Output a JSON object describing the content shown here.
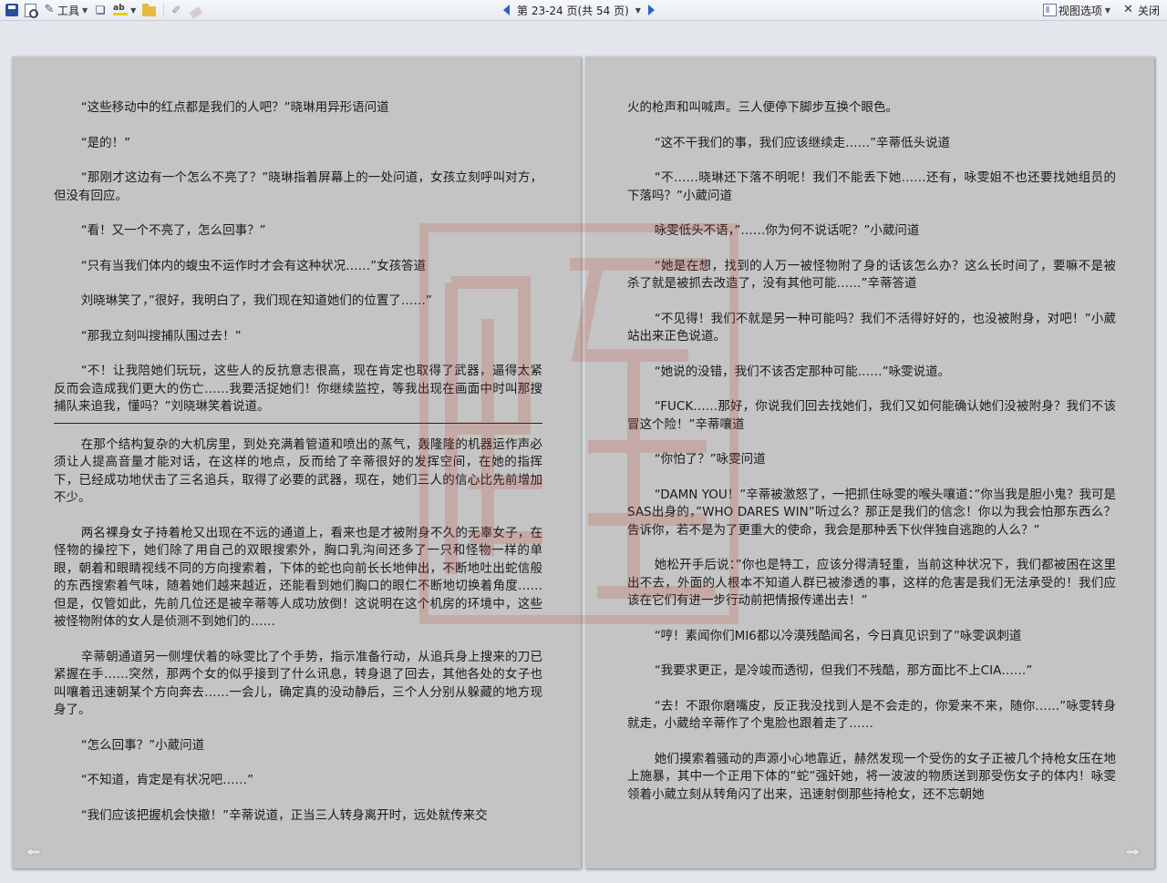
{
  "toolbar": {
    "tools_label": "工具",
    "page_info": "第 23-24 页(共 54 页)",
    "view_options_label": "视图选项",
    "close_label": "关闭"
  },
  "left_page": {
    "paragraphs": [
      "“这些移动中的红点都是我们的人吧？”晓琳用异形语问道",
      "“是的！”",
      "“那刚才这边有一个怎么不亮了？”晓琳指着屏幕上的一处问道，女孩立刻呼叫对方，但没有回应。",
      "“看！又一个不亮了，怎么回事？”",
      "“只有当我们体内的蝮虫不运作时才会有这种状况……”女孩答道",
      "刘晓琳笑了，”很好，我明白了，我们现在知道她们的位置了……”",
      "“那我立刻叫搜捕队围过去！”",
      "“不！让我陪她们玩玩，这些人的反抗意志很高，现在肯定也取得了武器，逼得太紧反而会造成我们更大的伤亡……我要活捉她们！你继续监控，等我出现在画面中时叫那搜捕队来追我，懂吗？”刘晓琳笑着说道。",
      "在那个结构复杂的大机房里，到处充满着管道和喷出的蒸气，轰隆隆的机器运作声必须让人提高音量才能对话，在这样的地点，反而给了辛蒂很好的发挥空间，在她的指挥下，已经成功地伏击了三名追兵，取得了必要的武器，现在，她们三人的信心比先前增加不少。",
      "两名裸身女子持着枪又出现在不远的通道上，看来也是才被附身不久的无辜女子，在怪物的操控下，她们除了用自己的双眼搜索外，胸口乳沟间还多了一只和怪物一样的单眼，朝着和眼睛视线不同的方向搜索着，下体的蛇也向前长长地伸出，不断地吐出蛇信般的东西搜索着气味，随着她们越来越近，还能看到她们胸口的眼仁不断地切换着角度……但是，仅管如此，先前几位还是被辛蒂等人成功放倒！这说明在这个机房的环境中，这些被怪物附体的女人是侦测不到她们的……",
      "辛蒂朝通道另一侧埋伏着的咏雯比了个手势，指示准备行动，从追兵身上搜来的刀已紧握在手……突然，那两个女的似乎接到了什么讯息，转身退了回去，其他各处的女子也叫嚷着迅速朝某个方向奔去……一会儿，确定真的没动静后，三个人分别从躲藏的地方现身了。",
      "“怎么回事？”小葳问道",
      "“不知道，肯定是有状况吧……”",
      "“我们应该把握机会快撤！”辛蒂说道，正当三人转身离开时，远处就传来交"
    ]
  },
  "right_page": {
    "paragraphs": [
      "火的枪声和叫喊声。三人便停下脚步互换个眼色。",
      "“这不干我们的事，我们应该继续走……”辛蒂低头说道",
      "“不……晓琳还下落不明呢！我们不能丢下她……还有，咏雯姐不也还要找她组员的下落吗？”小葳问道",
      "咏雯低头不语，”……你为何不说话呢？”小葳问道",
      "“她是在想，找到的人万一被怪物附了身的话该怎么办？这么长时间了，要嘛不是被杀了就是被抓去改造了，没有其他可能……”辛蒂答道",
      "“不见得！我们不就是另一种可能吗？我们不活得好好的，也没被附身，对吧！”小葳站出来正色说道。",
      "“她说的没错，我们不该否定那种可能……”咏雯说道。",
      "“FUCK……那好，你说我们回去找她们，我们又如何能确认她们没被附身？我们不该冒这个险！”辛蒂嚷道",
      "“你怕了？”咏雯问道",
      "“DAMN YOU！”辛蒂被激怒了，一把抓住咏雯的喉头嚷道：”你当我是胆小鬼？我可是SAS出身的，”WHO DARES WIN”听过么？那正是我们的信念！你以为我会怕那东西么？告诉你，若不是为了更重大的使命，我会是那种丢下伙伴独自逃跑的人么？”",
      "她松开手后说：”你也是特工，应该分得清轻重，当前这种状况下，我们都被困在这里出不去，外面的人根本不知道人群已被渗透的事，这样的危害是我们无法承受的！我们应该在它们有进一步行动前把情报传递出去！”",
      "“哼！素闻你们MI6都以冷漠残酷闻名，今日真见识到了”咏雯讽刺道",
      "“我要求更正，是冷竣而透彻，但我们不残酷，那方面比不上CIA……”",
      "“去！不跟你磨嘴皮，反正我没找到人是不会走的，你爱来不来，随你……”咏雯转身就走，小葳给辛蒂作了个鬼脸也跟着走了……",
      "她们摸索着骚动的声源小心地靠近，赫然发现一个受伤的女子正被几个持枪女压在地上施暴，其中一个正用下体的”蛇”强奸她，将一波波的物质送到那受伤女子的体内！咏雯领着小葳立刻从转角闪了出来，迅速射倒那些持枪女，还不忘朝她"
    ]
  },
  "colors": {
    "page_bg": "#c4c4c4",
    "desk_bg": "#e3e6ea",
    "nav_arrow": "#2c62c8",
    "watermark": "#c0392b"
  }
}
